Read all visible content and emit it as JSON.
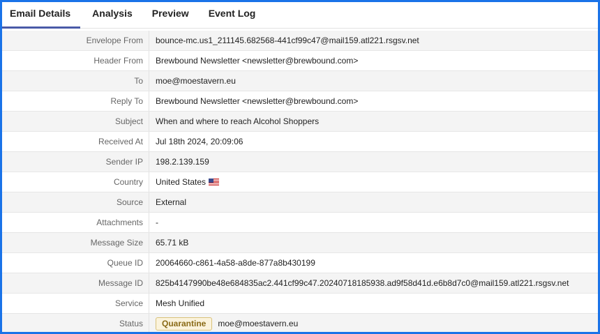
{
  "tabs": [
    "Email Details",
    "Analysis",
    "Preview",
    "Event Log"
  ],
  "active_tab": "Email Details",
  "rows": [
    {
      "label": "Envelope From",
      "value": "bounce-mc.us1_211145.682568-441cf99c47@mail159.atl221.rsgsv.net"
    },
    {
      "label": "Header From",
      "value": "Brewbound Newsletter <newsletter@brewbound.com>"
    },
    {
      "label": "To",
      "value": "moe@moestavern.eu"
    },
    {
      "label": "Reply To",
      "value": "Brewbound Newsletter <newsletter@brewbound.com>"
    },
    {
      "label": "Subject",
      "value": "When and where to reach Alcohol Shoppers"
    },
    {
      "label": "Received At",
      "value": "Jul 18th 2024, 20:09:06"
    },
    {
      "label": "Sender IP",
      "value": "198.2.139.159"
    },
    {
      "label": "Country",
      "value": "United States",
      "icon": "us-flag-icon"
    },
    {
      "label": "Source",
      "value": "External"
    },
    {
      "label": "Attachments",
      "value": "-"
    },
    {
      "label": "Message Size",
      "value": "65.71 kB"
    },
    {
      "label": "Queue ID",
      "value": "20064660-c861-4a58-a8de-877a8b430199"
    },
    {
      "label": "Message ID",
      "value": "825b4147990be48e684835ac2.441cf99c47.20240718185938.ad9f58d41d.e6b8d7c0@mail159.atl221.rsgsv.net"
    },
    {
      "label": "Service",
      "value": "Mesh Unified"
    },
    {
      "label": "Status",
      "badge": "Quarantine",
      "value": "moe@moestavern.eu"
    }
  ],
  "colors": {
    "frame": "#1a73e8",
    "badge_bg": "#fbf3dc",
    "badge_text": "#8a6a16",
    "tab_underline": "#4a5aa8"
  }
}
